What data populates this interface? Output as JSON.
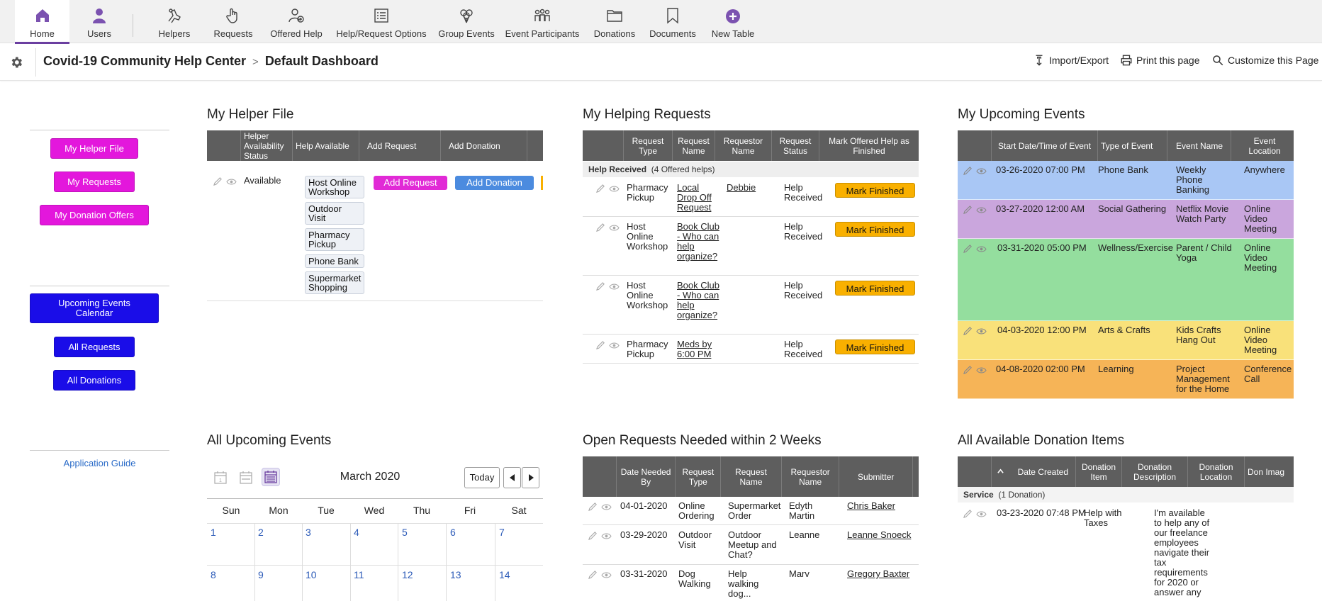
{
  "nav": {
    "items": [
      {
        "label": "Home",
        "icon": "home-icon"
      },
      {
        "label": "Users",
        "icon": "user-icon"
      },
      {
        "label": "Helpers",
        "icon": "helpers-icon"
      },
      {
        "label": "Requests",
        "icon": "hand-icon"
      },
      {
        "label": "Offered Help",
        "icon": "offered-help-icon"
      },
      {
        "label": "Help/Request Options",
        "icon": "list-icon"
      },
      {
        "label": "Group Events",
        "icon": "balloons-icon"
      },
      {
        "label": "Event Participants",
        "icon": "people-icon"
      },
      {
        "label": "Donations",
        "icon": "folder-icon"
      },
      {
        "label": "Documents",
        "icon": "bookmark-icon"
      },
      {
        "label": "New Table",
        "icon": "plus-circle-icon"
      }
    ]
  },
  "header": {
    "app_name": "Covid-19 Community Help Center",
    "breadcrumb_sep": ">",
    "page": "Default Dashboard",
    "import_export": "Import/Export",
    "print": "Print this page",
    "customize": "Customize this Page"
  },
  "sidebar": {
    "my_helper_file": "My Helper File",
    "my_requests": "My Requests",
    "my_donation_offers": "My Donation Offers",
    "upcoming_events_calendar": "Upcoming Events Calendar",
    "all_requests": "All Requests",
    "all_donations": "All Donations",
    "application_guide": "Application Guide"
  },
  "helper_file": {
    "title": "My Helper File",
    "headers": [
      "Helper Availability Status",
      "Help Available",
      "Add Request",
      "Add Donation"
    ],
    "status": "Available",
    "help_available": [
      "Host Online Workshop",
      "Outdoor Visit",
      "Pharmacy Pickup",
      "Phone Bank",
      "Supermarket Shopping"
    ],
    "add_request_btn": "Add Request",
    "add_donation_btn": "Add Donation"
  },
  "helping_requests": {
    "title": "My Helping Requests",
    "headers": [
      "Request Type",
      "Request Name",
      "Requestor Name",
      "Request Status",
      "Mark Offered Help as Finished"
    ],
    "group_label": "Help Received",
    "group_count": "(4 Offered helps)",
    "mark_btn": "Mark Finished",
    "rows": [
      {
        "type": "Pharmacy Pickup",
        "name": "Local Drop Off Request",
        "requestor": "Debbie",
        "status": "Help Received"
      },
      {
        "type": "Host Online Workshop",
        "name": "Book Club - Who can help organize?",
        "requestor": "",
        "status": "Help Received"
      },
      {
        "type": "Host Online Workshop",
        "name": "Book Club - Who can help organize?",
        "requestor": "",
        "status": "Help Received"
      },
      {
        "type": "Pharmacy Pickup",
        "name": "Meds by 6:00 PM",
        "requestor": "",
        "status": "Help Received"
      }
    ]
  },
  "upcoming_events": {
    "title": "My Upcoming Events",
    "headers": [
      "Start Date/Time of Event",
      "Type of Event",
      "Event Name",
      "Event Location"
    ],
    "rows": [
      {
        "start": "03-26-2020 07:00 PM",
        "type": "Phone Bank",
        "name": "Weekly Phone Banking",
        "location": "Anywhere",
        "color": "#a9c7f5"
      },
      {
        "start": "03-27-2020 12:00 AM",
        "type": "Social Gathering",
        "name": "Netflix Movie Watch Party",
        "location": "Online Video Meeting",
        "color": "#caa6dd"
      },
      {
        "start": "03-31-2020 05:00 PM",
        "type": "Wellness/Exercise",
        "name": "Parent / Child Yoga",
        "location": "Online Video Meeting",
        "color": "#94de9e"
      },
      {
        "start": "04-03-2020 12:00 PM",
        "type": "Arts & Crafts",
        "name": "Kids Crafts Hang Out",
        "location": "Online Video Meeting",
        "color": "#f9e17a"
      },
      {
        "start": "04-08-2020 02:00 PM",
        "type": "Learning",
        "name": "Project Management for the Home",
        "location": "Conference Call",
        "color": "#f6b457"
      }
    ]
  },
  "all_events": {
    "title": "All Upcoming Events",
    "month": "March 2020",
    "today": "Today",
    "days": [
      "Sun",
      "Mon",
      "Tue",
      "Wed",
      "Thu",
      "Fri",
      "Sat"
    ],
    "week1": [
      "1",
      "2",
      "3",
      "4",
      "5",
      "6",
      "7"
    ],
    "week2": [
      "8",
      "9",
      "10",
      "11",
      "12",
      "13",
      "14"
    ]
  },
  "open_requests": {
    "title": "Open Requests Needed within 2 Weeks",
    "headers": [
      "Date Needed By",
      "Request Type",
      "Request Name",
      "Requestor Name",
      "Submitter"
    ],
    "rows": [
      {
        "date": "04-01-2020",
        "type": "Online Ordering",
        "name": "Supermarket Order",
        "requestor": "Edyth Martin",
        "submitter": "Chris Baker"
      },
      {
        "date": "03-29-2020",
        "type": "Outdoor Visit",
        "name": "Outdoor Meetup and Chat?",
        "requestor": "Leanne",
        "submitter": "Leanne Snoeck"
      },
      {
        "date": "03-31-2020",
        "type": "Dog Walking",
        "name": "Help walking dog...",
        "requestor": "Marv",
        "submitter": "Gregory Baxter"
      }
    ]
  },
  "donations": {
    "title": "All Available Donation Items",
    "headers": [
      "Date Created",
      "Donation Item",
      "Donation Description",
      "Donation Location",
      "Donation Image"
    ],
    "header_last_visible": "Don Imag",
    "group_label": "Service",
    "group_count": "(1 Donation)",
    "rows": [
      {
        "date": "03-23-2020 07:48 PM",
        "item": "Help with Taxes",
        "description": "I'm available to help any of our freelance employees navigate their tax requirements for 2020 or answer any"
      }
    ]
  }
}
